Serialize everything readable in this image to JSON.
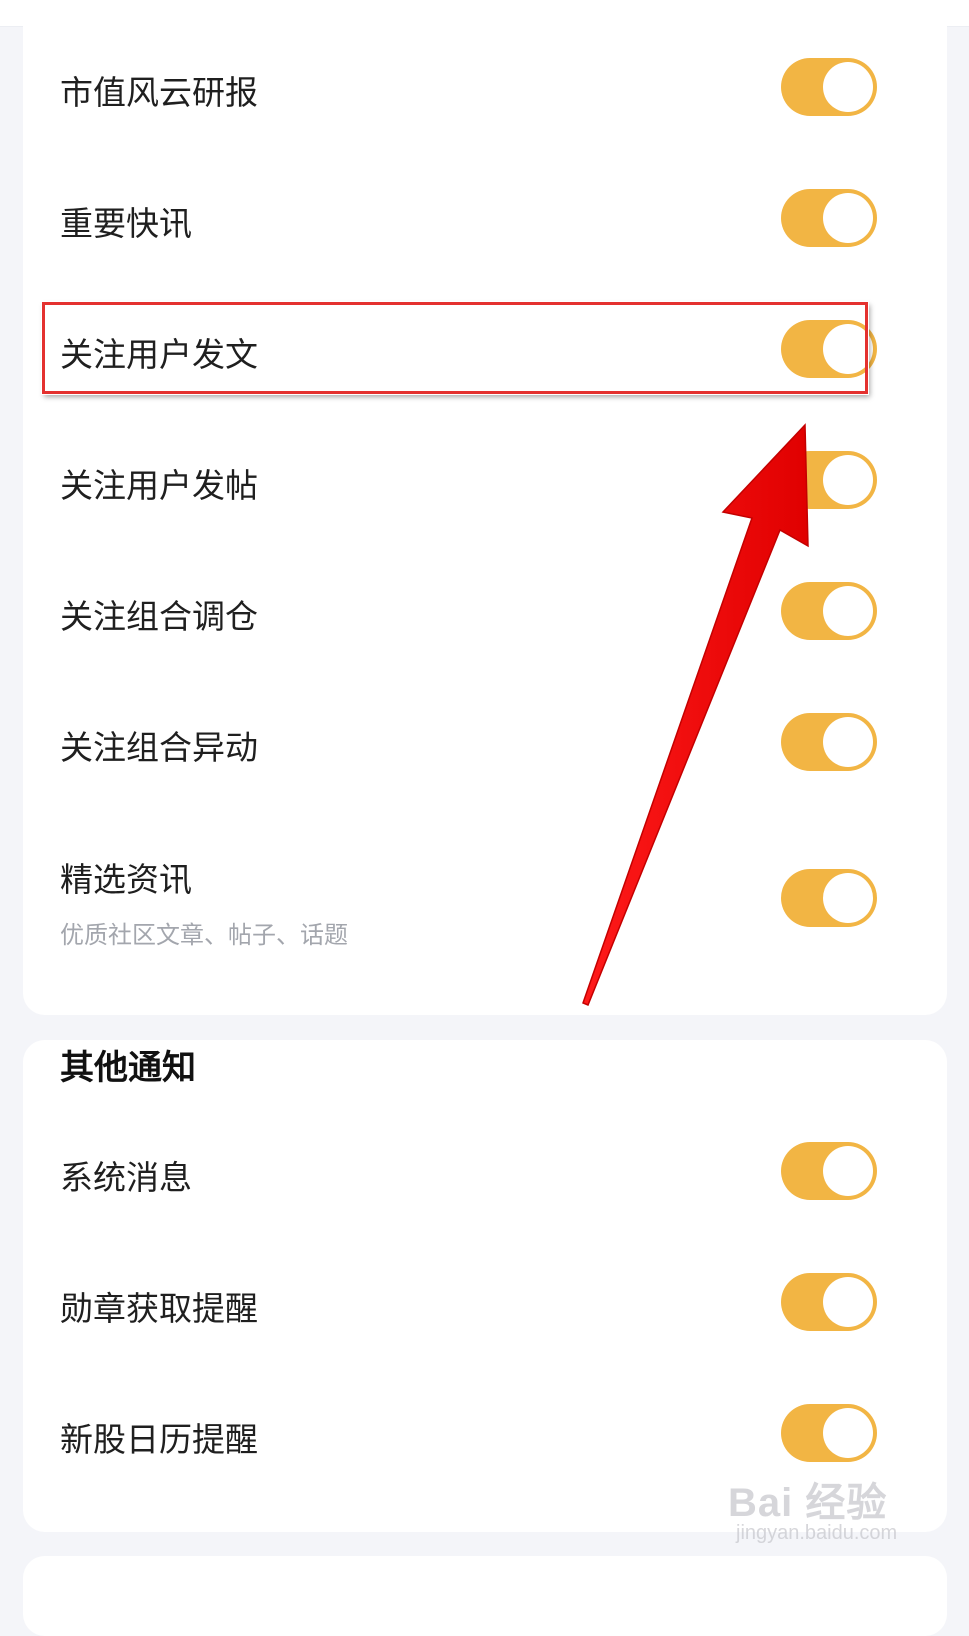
{
  "section_follow": {
    "items": [
      {
        "label": "市值风云研报",
        "on": true
      },
      {
        "label": "重要快讯",
        "on": true
      },
      {
        "label": "关注用户发文",
        "on": true,
        "highlighted": true
      },
      {
        "label": "关注用户发帖",
        "on": true
      },
      {
        "label": "关注组合调仓",
        "on": true
      },
      {
        "label": "关注组合异动",
        "on": true
      },
      {
        "label": "精选资讯",
        "sublabel": "优质社区文章、帖子、话题",
        "on": true
      }
    ]
  },
  "section_other": {
    "title": "其他通知",
    "items": [
      {
        "label": "系统消息",
        "on": true
      },
      {
        "label": "勋章获取提醒",
        "on": true
      },
      {
        "label": "新股日历提醒",
        "on": true
      }
    ]
  },
  "colors": {
    "toggle_on": "#f2b544",
    "highlight_border": "#e4312f",
    "arrow": "#ff0000",
    "background": "#f4f5f9"
  },
  "watermark": {
    "main": "Bai 经验",
    "sub": "jingyan.baidu.com"
  }
}
